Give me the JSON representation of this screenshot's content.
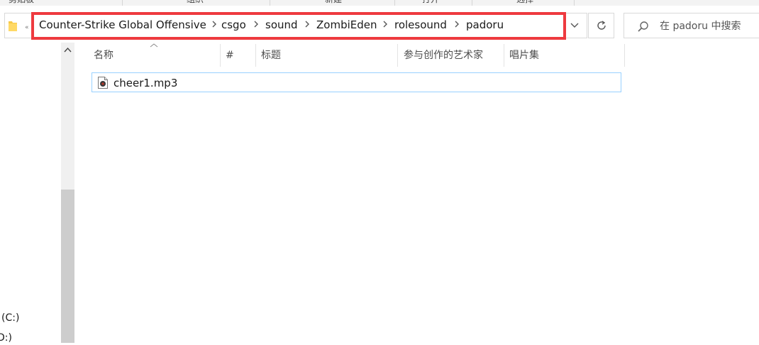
{
  "ribbon": {
    "groups": [
      "剪贴板",
      "组织",
      "新建",
      "打开",
      "选择"
    ]
  },
  "address_bar": {
    "overflow_glyph": "«",
    "crumbs": [
      "Counter-Strike Global Offensive",
      "csgo",
      "sound",
      "ZombiEden",
      "rolesound",
      "padoru"
    ],
    "highlight_color": "#ee3a3f",
    "folder_icon": "folder-icon",
    "separator_icon": "chevron-right-icon",
    "dropdown_icon": "chevron-down-icon",
    "refresh_icon": "refresh-icon"
  },
  "search": {
    "placeholder": "在 padoru 中搜索",
    "icon": "search-icon"
  },
  "nav_pane": {
    "items": [
      "(C:)",
      "D:)"
    ]
  },
  "columns": [
    "名称",
    "#",
    "标题",
    "参与创作的艺术家",
    "唱片集"
  ],
  "files": [
    {
      "name": "cheer1.mp3",
      "icon": "audio-file-icon"
    }
  ],
  "colors": {
    "selection_border": "#99d1ff",
    "scroll_thumb": "#cdcdcd"
  }
}
